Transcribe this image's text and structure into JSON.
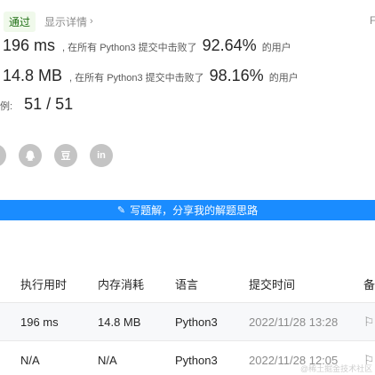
{
  "header": {
    "status_badge": "通过",
    "details_link": "显示详情",
    "cut_text": "F"
  },
  "runtime": {
    "value": "196 ms",
    "prefix": ", 在所有 Python3 提交中击败了",
    "percent": "92.64%",
    "suffix": "的用户"
  },
  "memory": {
    "value": "14.8 MB",
    "prefix": ", 在所有 Python3 提交中击败了",
    "percent": "98.16%",
    "suffix": "的用户"
  },
  "tests": {
    "label": "例:",
    "value": "51 / 51"
  },
  "shares": [
    {
      "name": "wechat",
      "text": ""
    },
    {
      "name": "qq",
      "text": ""
    },
    {
      "name": "douban",
      "text": "豆"
    },
    {
      "name": "linkedin",
      "text": "in"
    }
  ],
  "write_button": "写题解，分享我的解题思路",
  "table": {
    "headers": [
      "执行用时",
      "内存消耗",
      "语言",
      "提交时间",
      "备"
    ],
    "rows": [
      [
        "196 ms",
        "14.8 MB",
        "Python3",
        "2022/11/28 13:28"
      ],
      [
        "N/A",
        "N/A",
        "Python3",
        "2022/11/28 12:05"
      ]
    ]
  },
  "watermark": "@稀土掘金技术社区",
  "colors": {
    "accent": "#1a8cff",
    "badge_bg": "#f0f9eb",
    "badge_text": "#1f6f14",
    "icon_gray": "#c4c4c4"
  }
}
